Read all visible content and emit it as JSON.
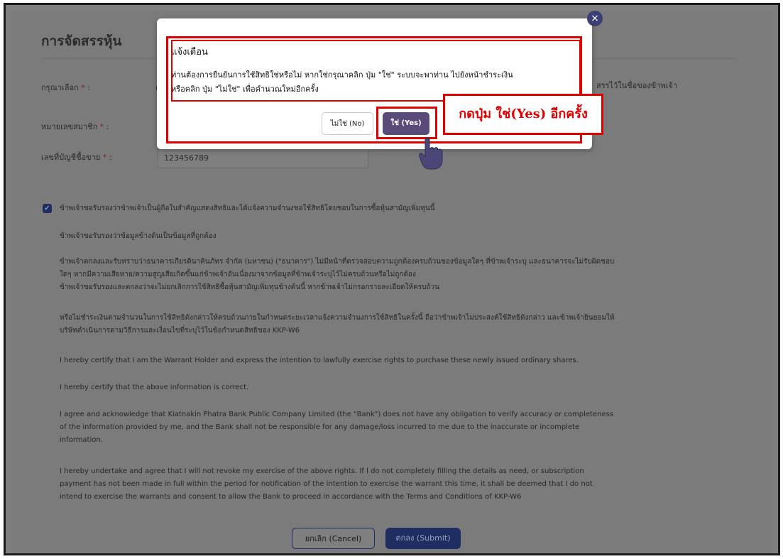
{
  "page": {
    "title": "การจัดสรรหุ้น",
    "choose_label": "กรุณาเลือก",
    "required_mark": "*",
    "colon": ":",
    "choose_option_partial": "สรรไว้ในชื่อของข้าพเจ้า",
    "member_label": "หมายเลขสมาชิก",
    "account_label": "เลขที่บัญชีซื้อขาย",
    "account_value": "123456789"
  },
  "declarations": {
    "checkbox_text": "ข้าพเจ้าขอรับรองว่าข้าพเจ้าเป็นผู้ถือใบสำคัญแสดงสิทธิและได้แจ้งความจำนงขอใช้สิทธิโดยชอบในการซื้อหุ้นสามัญเพิ่มทุนนี้",
    "th_p1": "ข้าพเจ้าขอรับรองว่าข้อมูลข้างต้นเป็นข้อมูลที่ถูกต้อง",
    "th_p2_l1": "ข้าพเจ้าตกลงและรับทราบว่าธนาคารเกียรตินาคินภัทร จำกัด (มหาชน) (\"ธนาคาร\") ไม่มีหน้าที่ตรวจสอบความถูกต้องครบถ้วนของข้อมูลใดๆ ที่ข้าพเจ้าระบุ และธนาคารจะไม่รับผิดชอบ",
    "th_p2_l2": "ใดๆ หากมีความเสียหาย/ความสูญเสียเกิดขึ้นแก่ข้าพเจ้าอันเนื่องมาจากข้อมูลที่ข้าพเจ้าระบุไว้ไม่ครบถ้วนหรือไม่ถูกต้อง",
    "th_p2_l3": "ข้าพเจ้าขอรับรองและตกลงว่าจะไม่ยกเลิกการใช้สิทธิซื้อหุ้นสามัญเพิ่มทุนข้างต้นนี้ หากข้าพเจ้าไม่กรอกรายละเอียดให้ครบถ้วน",
    "th_p3_l1": "หรือไม่ชำระเงินตามจำนวนในการใช้สิทธิดังกล่าวให้ครบถ้วนภายในกำหนดระยะเวลาแจ้งความจำนงการใช้สิทธิในครั้งนี้ ถือว่าข้าพเจ้าไม่ประสงค์ใช้สิทธิดังกล่าว และข้าพเจ้ายินยอมให้",
    "th_p3_l2": "บริษัทดำเนินการตามวิธีการและเงื่อนไขที่ระบุไว้ในข้อกำหนดสิทธิของ KKP-W6",
    "en_p1": "I hereby certify that I am the Warrant Holder and express the intention to lawfully exercise rights to purchase these newly issued ordinary shares.",
    "en_p2": "I hereby certify that the above information is correct.",
    "en_p3_l1": "I agree and acknowledge that Kiatnakin Phatra Bank Public Company Limited (the \"Bank\") does not have any obligation to verify accuracy or completeness",
    "en_p3_l2": "of the information provided by me, and the Bank shall not be responsible for any damage/loss incurred to me due to the inaccurate or incomplete",
    "en_p3_l3": "information.",
    "en_p4_l1": "I hereby undertake and agree that I will not revoke my exercise of the above rights. If I do not completely filling the details as need, or subscription",
    "en_p4_l2": "payment has not been made in full within the period for notification of the intention to exercise the warrant this time, it shall be deemed that I do not",
    "en_p4_l3": "intend to exercise the warrants and consent to allow the Bank to proceed in accordance with the Terms and Conditions of KKP-W6"
  },
  "actions": {
    "cancel_label": "ยกเลิก (Cancel)",
    "submit_label": "ตกลง (Submit)"
  },
  "modal": {
    "close_glyph": "×",
    "title": "แจ้งเตือน",
    "message_l1": "ท่านต้องการยืนยันการใช้สิทธิใช่หรือไม่ หากใช่กรุณาคลิก ปุ่ม \"ใช่\" ระบบจะพาท่าน ไปยังหน้าชำระเงิน",
    "message_l2": "หรือคลิก ปุ่ม \"ไม่ใช่\" เพื่อคำนวณใหม่อีกครั้ง",
    "no_label": "ไม่ใช่ (No)",
    "yes_label": "ใช่ (Yes)"
  },
  "annotation": {
    "callout_text": "กดปุ่ม ใช่(Yes) อีกครั้ง",
    "highlight_color": "#e00000"
  },
  "colors": {
    "primary": "#1e2e62",
    "yes_button": "#5a4a7a",
    "overlay": "#7b7b7b"
  }
}
